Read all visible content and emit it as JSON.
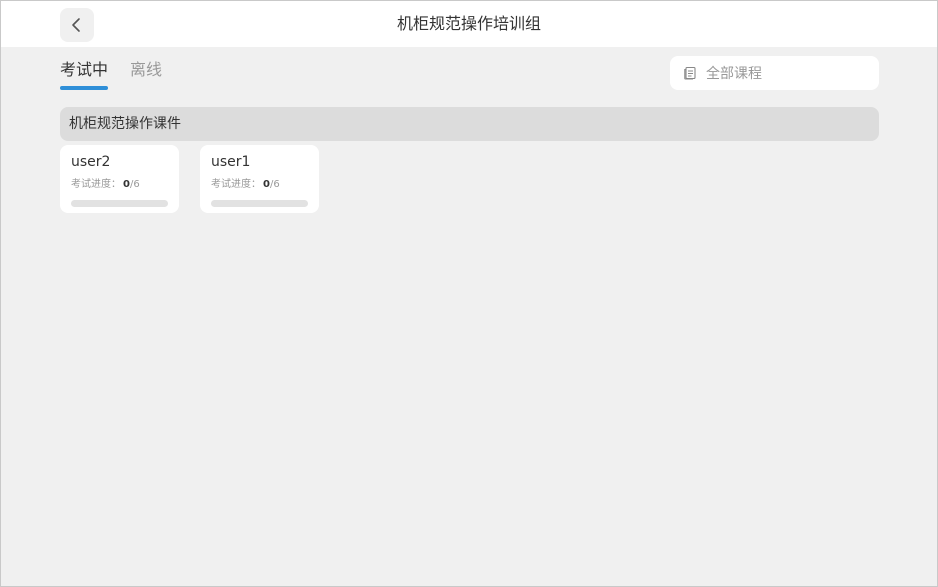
{
  "header": {
    "title": "机柜规范操作培训组",
    "back_icon": "chevron-left-icon"
  },
  "tabs": [
    {
      "label": "考试中",
      "active": true
    },
    {
      "label": "离线",
      "active": false
    }
  ],
  "course_filter": {
    "label": "全部课程",
    "icon": "document-list-icon"
  },
  "section": {
    "title": "机柜规范操作课件"
  },
  "cards": [
    {
      "name": "user2",
      "progress_label": "考试进度：",
      "current": "0",
      "total": "/6",
      "progress": 0
    },
    {
      "name": "user1",
      "progress_label": "考试进度：",
      "current": "0",
      "total": "/6",
      "progress": 0
    }
  ],
  "colors": {
    "accent": "#2f8fd8",
    "background": "#f0f0f0",
    "section_bg": "#dcdcdc"
  }
}
